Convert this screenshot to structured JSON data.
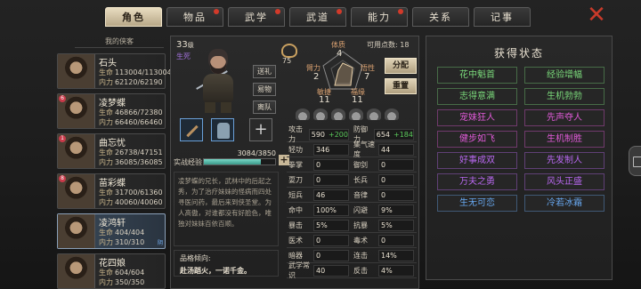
{
  "tabs": [
    {
      "label": "角色",
      "active": true,
      "dot": false
    },
    {
      "label": "物品",
      "active": false,
      "dot": true
    },
    {
      "label": "武学",
      "active": false,
      "dot": true
    },
    {
      "label": "武道",
      "active": false,
      "dot": true
    },
    {
      "label": "能力",
      "active": false,
      "dot": true
    },
    {
      "label": "关系",
      "active": false,
      "dot": false
    },
    {
      "label": "记事",
      "active": false,
      "dot": false
    }
  ],
  "close_glyph": "✕",
  "list_title": "我的侠客",
  "characters": [
    {
      "name": "石头",
      "hp_label": "生命",
      "hp": "113004/113004",
      "mp_label": "内力",
      "mp": "62120/62190",
      "level_mark": "",
      "selected": false
    },
    {
      "name": "凌梦蝶",
      "hp_label": "生命",
      "hp": "46866/72380",
      "mp_label": "内力",
      "mp": "66460/66460",
      "level_mark": "6",
      "selected": false
    },
    {
      "name": "曲忘忧",
      "hp_label": "生命",
      "hp": "26738/47151",
      "mp_label": "内力",
      "mp": "36085/36085",
      "level_mark": "1",
      "selected": false
    },
    {
      "name": "苗彩蝶",
      "hp_label": "生命",
      "hp": "31700/61360",
      "mp_label": "内力",
      "mp": "40060/40060",
      "level_mark": "8",
      "selected": false
    },
    {
      "name": "凌鸿轩",
      "hp_label": "生命",
      "hp": "404/404",
      "mp_label": "内力",
      "mp": "310/310",
      "level_mark": "",
      "selected": true,
      "tag": "阴"
    },
    {
      "name": "花四娘",
      "hp_label": "生命",
      "hp": "604/604",
      "mp_label": "内力",
      "mp": "350/350",
      "level_mark": "",
      "selected": false
    }
  ],
  "hero": {
    "level": "33",
    "level_suffix": "级",
    "state": "生死",
    "buttons": {
      "gift": "送礼",
      "trade": "易物",
      "leave": "离队"
    },
    "exp_label": "实战经验",
    "exp_text": "3084/3850",
    "exp_fraction": 0.801,
    "description": "凌梦蝶的兄长，武林中的后起之秀，为了治疗妹妹的怪病而四处寻医问药，最后来到侠圣堂。为人高傲，对谁都没有好脸色，唯独对妹妹百依百顺。",
    "trait_label": "品格倾向:",
    "trait_value": "赴汤蹈火，一诺千金。",
    "aptitude": "75",
    "available_points_label": "可用点数:",
    "available_points": "18",
    "allocate": "分配",
    "reset": "重置"
  },
  "attributes": [
    {
      "name": "体质",
      "value": "4"
    },
    {
      "name": "悟性",
      "value": "7"
    },
    {
      "name": "福缘",
      "value": "11"
    },
    {
      "name": "敏捷",
      "value": "11"
    },
    {
      "name": "臂力",
      "value": "2"
    }
  ],
  "stats": [
    [
      {
        "k": "攻击力",
        "v": "590",
        "bonus": "+200"
      },
      {
        "k": "防御力",
        "v": "654",
        "bonus": "+184"
      }
    ],
    [
      {
        "k": "轻功",
        "v": "346"
      },
      {
        "k": "集气速度",
        "v": "44"
      }
    ],
    [
      {
        "k": "拳掌",
        "v": "0"
      },
      {
        "k": "御剑",
        "v": "0"
      }
    ],
    [
      {
        "k": "耍刀",
        "v": "0"
      },
      {
        "k": "长兵",
        "v": "0"
      }
    ],
    [
      {
        "k": "短兵",
        "v": "46"
      },
      {
        "k": "音律",
        "v": "0"
      }
    ],
    [
      {
        "k": "命中",
        "v": "100%"
      },
      {
        "k": "闪避",
        "v": "9%"
      }
    ],
    [
      {
        "k": "暴击",
        "v": "5%"
      },
      {
        "k": "抗暴",
        "v": "5%"
      }
    ],
    [
      {
        "k": "医术",
        "v": "0"
      },
      {
        "k": "毒术",
        "v": "0"
      }
    ],
    [
      {
        "k": "暗器",
        "v": "0"
      },
      {
        "k": "连击",
        "v": "14%"
      }
    ],
    [
      {
        "k": "武学常识",
        "v": "40"
      },
      {
        "k": "反击",
        "v": "4%"
      }
    ]
  ],
  "status_panel": {
    "title": "获得状态",
    "items": [
      {
        "label": "花中魁首",
        "color": "#7ad87a"
      },
      {
        "label": "经验增幅",
        "color": "#7ad87a"
      },
      {
        "label": "志得意满",
        "color": "#7ad87a"
      },
      {
        "label": "生机勃勃",
        "color": "#7ad87a"
      },
      {
        "label": "宠妹狂人",
        "color": "#e05ad8"
      },
      {
        "label": "先声夺人",
        "color": "#e05ad8"
      },
      {
        "label": "健步如飞",
        "color": "#e05ad8"
      },
      {
        "label": "生机制胜",
        "color": "#e05ad8"
      },
      {
        "label": "好事成双",
        "color": "#b868f0"
      },
      {
        "label": "先发制人",
        "color": "#b868f0"
      },
      {
        "label": "万夫之勇",
        "color": "#b868f0"
      },
      {
        "label": "风头正盛",
        "color": "#b868f0"
      },
      {
        "label": "生无可恋",
        "color": "#68a8f0"
      },
      {
        "label": "冷若冰霜",
        "color": "#68a8f0"
      }
    ]
  }
}
